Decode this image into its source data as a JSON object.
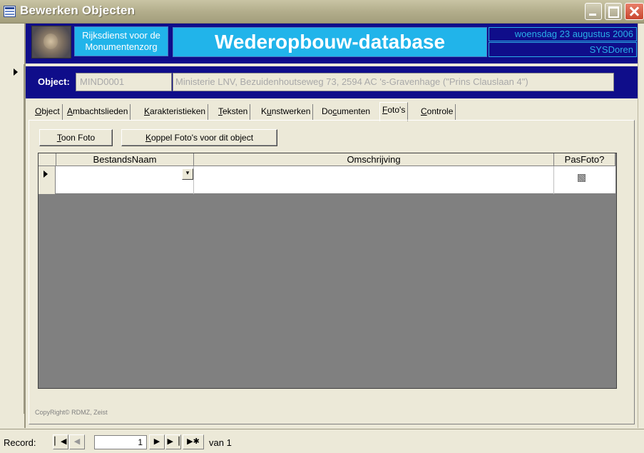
{
  "window": {
    "title": "Bewerken Objecten"
  },
  "header": {
    "org": "Rijksdienst voor de Monumentenzorg",
    "db_title": "Wederopbouw-database",
    "date": "woensdag 23 augustus 2006",
    "user": "SYSDoren"
  },
  "object": {
    "label": "Object:",
    "code": "MIND0001",
    "description": "Ministerie LNV, Bezuidenhoutseweg 73, 2594 AC 's-Gravenhage (\"Prins Clauslaan 4\")"
  },
  "tabs": [
    {
      "pre": "",
      "key": "O",
      "post": "bject"
    },
    {
      "pre": "",
      "key": "A",
      "post": "mbachtslieden"
    },
    {
      "pre": "",
      "key": "K",
      "post": "arakteristieken"
    },
    {
      "pre": "",
      "key": "T",
      "post": "eksten"
    },
    {
      "pre": "K",
      "key": "u",
      "post": "nstwerken"
    },
    {
      "pre": "Do",
      "key": "c",
      "post": "umenten"
    },
    {
      "pre": "",
      "key": "F",
      "post": "oto's"
    },
    {
      "pre": "",
      "key": "C",
      "post": "ontrole"
    }
  ],
  "active_tab": "Foto's",
  "buttons": {
    "toon": {
      "key": "T",
      "rest": "oon Foto"
    },
    "koppel": {
      "key": "K",
      "rest": "oppel Foto's voor dit object"
    }
  },
  "grid": {
    "columns": [
      "BestandsNaam",
      "Omschrijving",
      "PasFoto?"
    ]
  },
  "copyright": "CopyRight© RDMZ, Zeist",
  "nav": {
    "label": "Record:",
    "current": "1",
    "total": "van 1"
  },
  "icons": [
    "first-record-icon",
    "prev-record-icon",
    "next-record-icon",
    "last-record-icon",
    "new-record-icon",
    "combo-arrow-icon"
  ]
}
